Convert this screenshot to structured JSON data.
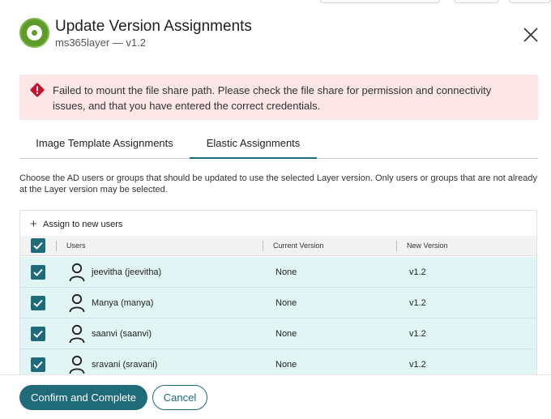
{
  "dialog": {
    "title": "Update Version Assignments",
    "subtitle": "ms365layer — v1.2",
    "icons": {
      "logo": "layer-disc-icon",
      "close": "close-icon"
    }
  },
  "error": {
    "icon": "error-diamond-icon",
    "message": "Failed to mount the file share path. Please check the file share for permission and connectivity issues, and that you have entered the correct credentials.",
    "color": "#fde6e6"
  },
  "tabs": [
    {
      "label": "Image Template Assignments",
      "active": false
    },
    {
      "label": "Elastic Assignments",
      "active": true
    }
  ],
  "description": "Choose the AD users or groups that should be updated to use the selected Layer version. Only users or groups that are not already at the Layer version may be selected.",
  "table": {
    "assign_label": "Assign to new users",
    "assign_icon": "plus-icon",
    "columns": [
      "Users",
      "Current Version",
      "New Version"
    ],
    "header_checked": true,
    "rows": [
      {
        "user": "jeevitha (jeevitha)",
        "current": "None",
        "new": "v1.2",
        "checked": true
      },
      {
        "user": "Manya (manya)",
        "current": "None",
        "new": "v1.2",
        "checked": true
      },
      {
        "user": "saanvi (saanvi)",
        "current": "None",
        "new": "v1.2",
        "checked": true
      },
      {
        "user": "sravani (sravani)",
        "current": "None",
        "new": "v1.2",
        "checked": true
      }
    ]
  },
  "footer": {
    "confirm_label": "Confirm and Complete",
    "cancel_label": "Cancel"
  },
  "colors": {
    "accent": "#1f6b7a",
    "row_selected": "#e0f5f4",
    "logo_green": "#5e9c2a"
  }
}
